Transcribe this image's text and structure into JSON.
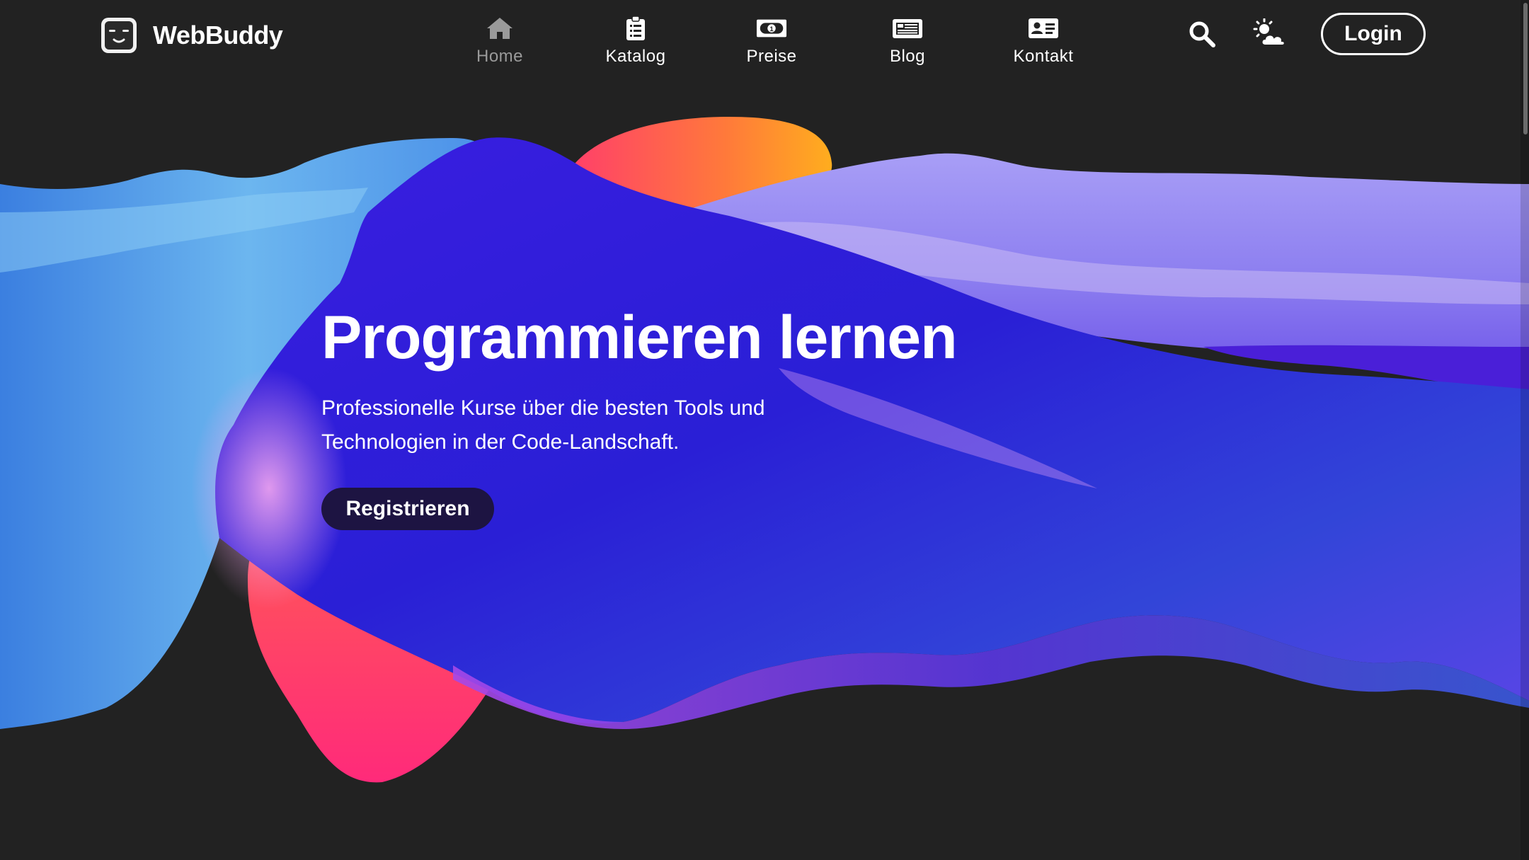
{
  "brand": {
    "name": "WebBuddy",
    "logo_icon": "robot-face-icon"
  },
  "nav": {
    "items": [
      {
        "label": "Home",
        "icon": "home-icon",
        "active": true
      },
      {
        "label": "Katalog",
        "icon": "clipboard-list-icon",
        "active": false
      },
      {
        "label": "Preise",
        "icon": "money-bill-icon",
        "active": false
      },
      {
        "label": "Blog",
        "icon": "newspaper-icon",
        "active": false
      },
      {
        "label": "Kontakt",
        "icon": "address-card-icon",
        "active": false
      }
    ]
  },
  "header_tools": {
    "search_icon": "search-icon",
    "theme_icon": "sun-cloud-icon",
    "login_label": "Login"
  },
  "hero": {
    "title": "Programmieren lernen",
    "subtitle": "Professionelle Kurse über die besten Tools und Technologien in der Code-Landschaft.",
    "cta_label": "Registrieren"
  },
  "colors": {
    "background": "#222222",
    "text": "#ffffff",
    "active_nav": "#9a9a9a",
    "cta_background": "#1d1442"
  }
}
